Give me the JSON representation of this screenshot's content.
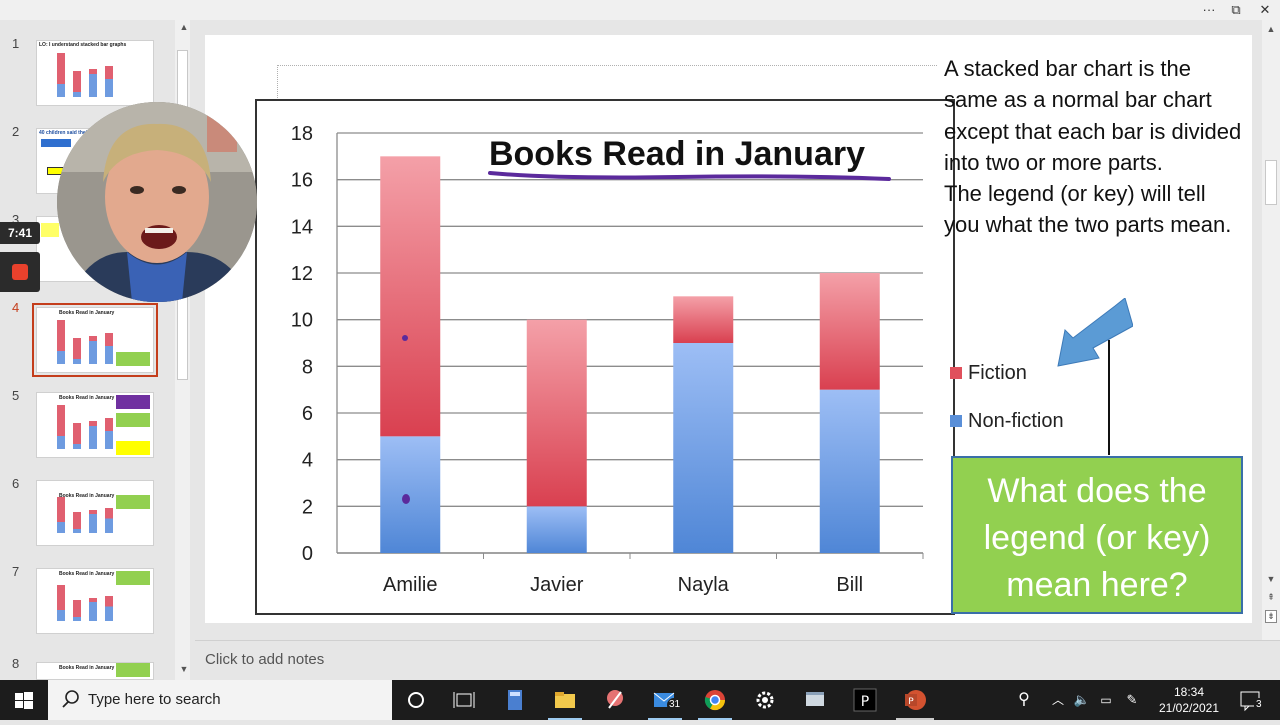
{
  "titlebar": {
    "more_label": "···",
    "restore_label": "⧉",
    "close_label": "✕"
  },
  "thumbnails": [
    {
      "number": "1",
      "title": "LO: I understand stacked bar graphs"
    },
    {
      "number": "2",
      "title": "40 children said their Maths"
    },
    {
      "number": "3",
      "title": ""
    },
    {
      "number": "4",
      "title": "Books Read in January",
      "box": "What does the legend (or key) mean here?"
    },
    {
      "number": "5",
      "title": "Books Read in January",
      "box": "Who read most books?"
    },
    {
      "number": "6",
      "title": "Books Read in January",
      "box": "How many fiction books did Javier read?"
    },
    {
      "number": "7",
      "title": "Books Read in January",
      "box": "How many more fiction books did Amilie read?"
    },
    {
      "number": "8",
      "title": "Books Read in January",
      "box": "How many fiction books did Nayla read?"
    }
  ],
  "recording": {
    "timer": "7:41"
  },
  "slide": {
    "description_lines": [
      "A stacked bar chart is the same as a normal bar chart except that each bar is divided into two or more parts.",
      "The legend (or key) will tell you what the two parts mean."
    ],
    "legend": [
      {
        "label": "Fiction",
        "color": "#e0505c"
      },
      {
        "label": "Non-fiction",
        "color": "#5a8fd8"
      }
    ],
    "question": "What does the legend (or key) mean here?"
  },
  "chart_data": {
    "type": "bar",
    "stacked": true,
    "title": "Books Read in January",
    "categories": [
      "Amilie",
      "Javier",
      "Nayla",
      "Bill"
    ],
    "series": [
      {
        "name": "Non-fiction",
        "values": [
          5,
          2,
          9,
          7
        ],
        "color": "#5a8fd8"
      },
      {
        "name": "Fiction",
        "values": [
          12,
          8,
          2,
          5
        ],
        "color": "#e0505c"
      }
    ],
    "yticks": [
      "0",
      "2",
      "4",
      "6",
      "8",
      "10",
      "12",
      "14",
      "16",
      "18"
    ],
    "ylim": [
      0,
      18
    ],
    "grid": true,
    "legend_position": "right"
  },
  "notes": {
    "placeholder": "Click to add notes"
  },
  "taskbar": {
    "search_placeholder": "Type here to search",
    "mail_badge": "31",
    "time": "18:34",
    "date": "21/02/2021",
    "notification_count": "3"
  }
}
